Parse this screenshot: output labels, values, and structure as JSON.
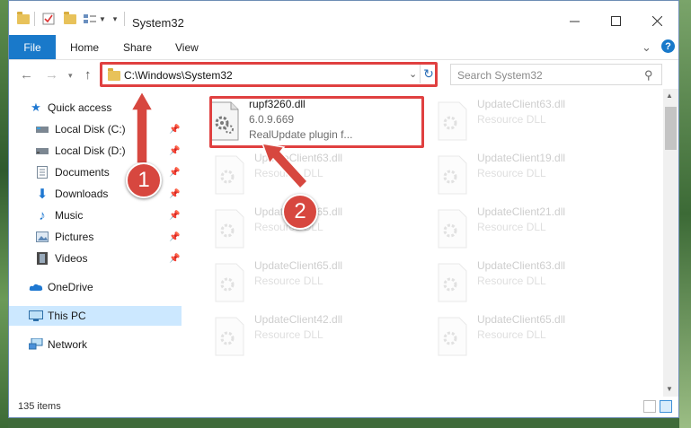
{
  "window": {
    "title": "System32"
  },
  "ribbon": {
    "tabs": [
      "File",
      "Home",
      "Share",
      "View"
    ],
    "help": "?"
  },
  "nav": {
    "address": "C:\\Windows\\System32",
    "search_placeholder": "Search System32"
  },
  "sidebar": {
    "items": [
      {
        "label": "Quick access",
        "icon": "star-icon",
        "pinned": false
      },
      {
        "label": "Local Disk (C:)",
        "icon": "drive-icon",
        "pinned": true
      },
      {
        "label": "Local Disk (D:)",
        "icon": "drive-icon",
        "pinned": true
      },
      {
        "label": "Documents",
        "icon": "document-icon",
        "pinned": true
      },
      {
        "label": "Downloads",
        "icon": "download-icon",
        "pinned": true
      },
      {
        "label": "Music",
        "icon": "music-icon",
        "pinned": true
      },
      {
        "label": "Pictures",
        "icon": "pictures-icon",
        "pinned": true
      },
      {
        "label": "Videos",
        "icon": "video-icon",
        "pinned": true
      },
      {
        "label": "OneDrive",
        "icon": "cloud-icon",
        "pinned": false
      },
      {
        "label": "This PC",
        "icon": "computer-icon",
        "pinned": false,
        "selected": true
      },
      {
        "label": "Network",
        "icon": "network-icon",
        "pinned": false
      }
    ]
  },
  "files": [
    {
      "name": "rupf3260.dll",
      "line1": "6.0.9.669",
      "line2": "RealUpdate plugin f..."
    },
    {
      "name": "UpdateClient63.dll",
      "line1": "Resource DLL"
    },
    {
      "name": "UpdateClient63.dll",
      "line1": "Resource DLL"
    },
    {
      "name": "UpdateClient19.dll",
      "line1": "Resource DLL"
    },
    {
      "name": "UpdateClient65.dll",
      "line1": "Resource DLL"
    },
    {
      "name": "UpdateClient21.dll",
      "line1": "Resource DLL"
    },
    {
      "name": "UpdateClient65.dll",
      "line1": "Resource DLL"
    },
    {
      "name": "UpdateClient63.dll",
      "line1": "Resource DLL"
    },
    {
      "name": "UpdateClient42.dll",
      "line1": "Resource DLL"
    },
    {
      "name": "UpdateClient65.dll",
      "line1": "Resource DLL"
    }
  ],
  "status": {
    "items": "135 items"
  },
  "annotations": {
    "step1": "1",
    "step2": "2",
    "color": "#d7473f"
  },
  "colors": {
    "accent": "#1979ca",
    "highlight": "#e04040",
    "selection": "#cce8ff"
  }
}
